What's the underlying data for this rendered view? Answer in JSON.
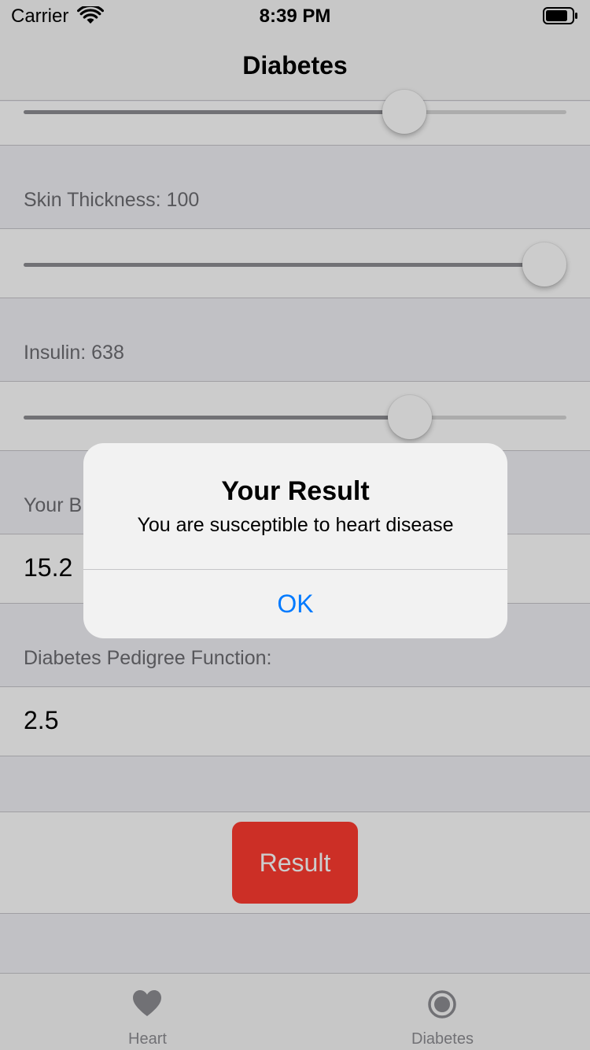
{
  "status_bar": {
    "carrier": "Carrier",
    "time": "8:39 PM",
    "wifi_icon": "wifi-icon",
    "battery_icon": "battery-icon"
  },
  "nav": {
    "title": "Diabetes"
  },
  "form": {
    "first_slider": {
      "value_fraction": 0.72
    },
    "skin_thickness": {
      "label": "Skin Thickness: 100",
      "value_fraction": 1.0
    },
    "insulin": {
      "label": "Insulin: 638",
      "value_fraction": 0.73
    },
    "bmi": {
      "label": "Your BMI:",
      "value": "15.2"
    },
    "pedigree": {
      "label": "Diabetes Pedigree Function:",
      "value": "2.5"
    }
  },
  "result_button": {
    "label": "Result",
    "color": "#ff3b30"
  },
  "tab_bar": {
    "items": [
      {
        "label": "Heart",
        "icon": "heart-icon"
      },
      {
        "label": "Diabetes",
        "icon": "record-icon"
      }
    ]
  },
  "alert": {
    "title": "Your Result",
    "message": "You are susceptible to heart disease",
    "ok_label": "OK",
    "ok_color": "#007aff"
  }
}
